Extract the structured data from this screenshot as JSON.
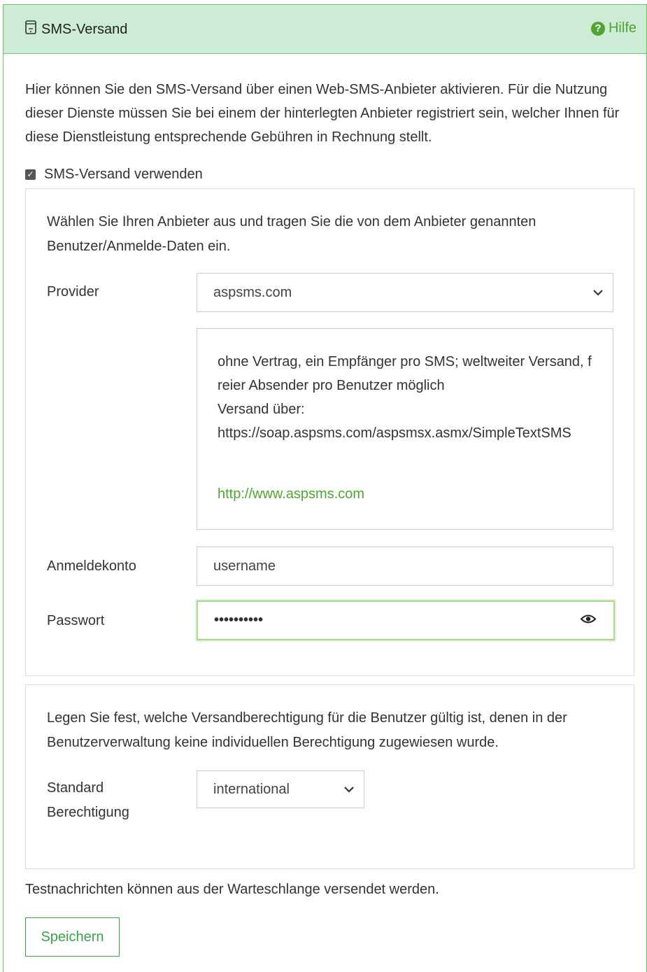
{
  "header": {
    "title": "SMS-Versand",
    "help_label": "Hilfe"
  },
  "intro": "Hier können Sie den SMS-Versand über einen Web-SMS-Anbieter aktivieren. Für die Nutzung dieser Dienste müssen Sie bei einem der hinterlegten Anbieter registriert sein, welcher Ihnen für diese Dienstleistung entsprechende Gebühren in Rechnung stellt.",
  "checkbox": {
    "label": "SMS-Versand verwenden",
    "checked": true
  },
  "provider_section": {
    "description": "Wählen Sie Ihren Anbieter aus und tragen Sie die von dem Anbieter genannten Benutzer/Anmelde-Daten ein.",
    "provider_label": "Provider",
    "provider_value": "aspsms.com",
    "info_line1": "ohne Vertrag, ein Empfänger pro SMS; weltweiter Versand, freier Absender pro Benutzer möglich",
    "info_line2": "Versand über:",
    "info_line3": "https://soap.aspsms.com/aspsmsx.asmx/SimpleTextSMS",
    "info_link": "http://www.aspsms.com",
    "account_label": "Anmeldekonto",
    "account_value": "username",
    "password_label": "Passwort",
    "password_value": "••••••••••"
  },
  "permission_section": {
    "description": "Legen Sie fest, welche Versandberechtigung für die Benutzer gültig ist, denen in der Benutzerverwaltung keine individuellen Berechtigung zugewiesen wurde.",
    "standard_label": "Standard Berechtigung",
    "standard_value": "international"
  },
  "footer": {
    "note": "Testnachrichten können aus der Warteschlange versendet werden.",
    "save_label": "Speichern"
  },
  "colors": {
    "accent": "#4ea52f",
    "header_bg": "#cdebd5",
    "border": "#6fbf6b"
  }
}
